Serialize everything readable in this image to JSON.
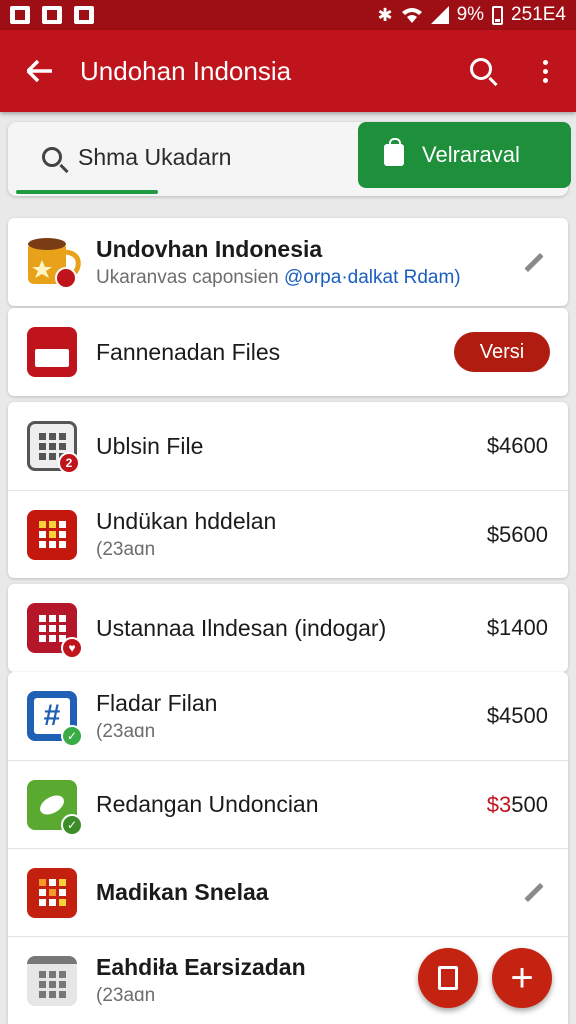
{
  "status": {
    "battery": "9%",
    "clock": "251E4"
  },
  "appbar": {
    "title": "Undohan Indonsia"
  },
  "search": {
    "text": "Shma  Ukadarn"
  },
  "action_button": {
    "label": "Velraraval"
  },
  "profile": {
    "title": "Undovhan Indonesia",
    "subtitle": "Ukaranvas caponsien ",
    "link": "@orpa·dalkat Rdam)"
  },
  "files_row": {
    "label": "Fannenadan Files",
    "badge": "Versi"
  },
  "items": [
    {
      "title": "Ublsin File",
      "price": "$4600"
    },
    {
      "title": "Undükan hddelan",
      "sub": "(23aɑn",
      "price": "$5600"
    },
    {
      "title": "Ustannaa Ilndesan (indogar)",
      "price": "$1400"
    },
    {
      "title": "Fladar Filan",
      "sub": "(23aɑn",
      "price": "$4500"
    },
    {
      "title": "Redangan Undoncian",
      "price_prefix": "$3",
      "price_rest": "500"
    },
    {
      "title": "Madikan Snelaa"
    },
    {
      "title": "Eahdiła Earsizadan",
      "sub": "(23aɑn"
    }
  ],
  "colors": {
    "brand_red": "#c0141c",
    "status_red": "#9e0f15",
    "action_green": "#1e8f3a",
    "link_blue": "#1a5fbf"
  },
  "icons": [
    "back-arrow-icon",
    "search-icon",
    "more-vert-icon",
    "shopping-bag-icon",
    "coffee-cup-icon",
    "calendar-icon",
    "grid-document-icon",
    "grid-calendar-icon",
    "hash-grid-icon",
    "green-leaf-icon",
    "pencil-icon",
    "calculator-icon",
    "edit-document-icon",
    "plus-icon"
  ]
}
